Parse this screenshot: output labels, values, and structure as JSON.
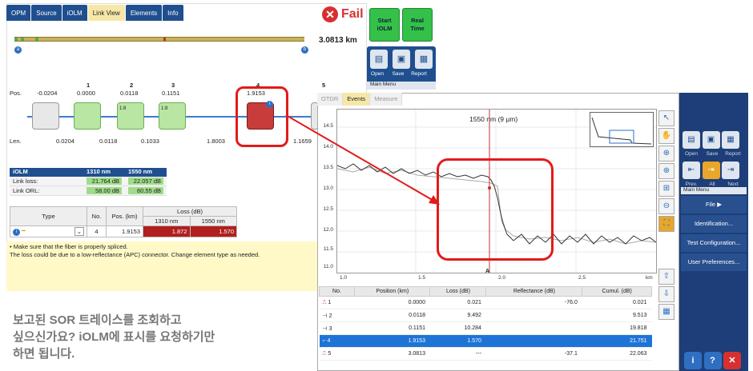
{
  "iolm": {
    "tabs": [
      "OPM",
      "Source",
      "iOLM",
      "Link View",
      "Elements",
      "Info"
    ],
    "active_tab": "Link View",
    "status": "Fail",
    "start_iolm_label": "Start\niOLM",
    "real_time_label": "Real\nTime",
    "toolbar": {
      "open": "Open",
      "save": "Save",
      "report": "Report"
    },
    "main_menu": "Main Menu",
    "total_distance": "3.0813 km",
    "pos_label": "Pos.",
    "len_label": "Len.",
    "positions": [
      "-0.0204",
      "0.0000",
      "0.0118",
      "0.1151",
      "1.9153"
    ],
    "indices": [
      "1",
      "2",
      "3",
      "4",
      "5"
    ],
    "lengths": [
      "0.0204",
      "0.0118",
      "0.1033",
      "1.8003",
      "1.1659"
    ],
    "splitter_label": "1:8",
    "results": {
      "header": [
        "iOLM",
        "1310 nm",
        "1550 nm"
      ],
      "rows": [
        {
          "label": "Link loss:",
          "v1310": "21.764 dB",
          "v1550": "22.057 dB"
        },
        {
          "label": "Link ORL:",
          "v1310": "58.00 dB",
          "v1550": "60.55 dB"
        }
      ]
    },
    "event_table": {
      "headers": [
        "Type",
        "No.",
        "Pos. (km)",
        "Loss (dB)"
      ],
      "subheaders": [
        "1310 nm",
        "1550 nm"
      ],
      "row": {
        "no": "4",
        "pos": "1.9153",
        "loss1310": "1.872",
        "loss1550": "1.570"
      }
    },
    "note_lines": [
      "• Make sure that the fiber is properly spliced.",
      "The loss could be due to a low-reflectance (APC) connector. Change element type as needed."
    ]
  },
  "caption": [
    "보고된 SOR 트레이스를 조회하고",
    "싶으신가요? iOLM에 표시를 요청하기만",
    "하면 됩니다."
  ],
  "otdr": {
    "tabs": [
      "OTDR",
      "Events",
      "Measure"
    ],
    "active_tab": "Events",
    "wavelength_label": "1550 nm (9 µm)",
    "marker_label": "A",
    "y_ticks": [
      "14.5",
      "14.0",
      "13.5",
      "13.0",
      "12.5",
      "12.0",
      "11.5",
      "11.0"
    ],
    "x_ticks": [
      "1.0",
      "1.5",
      "2.0",
      "2.5",
      "km"
    ],
    "table_headers": [
      "No.",
      "Position (km)",
      "Loss (dB)",
      "Reflectance (dB)",
      "Cumul. (dB)"
    ],
    "rows": [
      {
        "no": "1",
        "pos": "0.0000",
        "loss": "0.021",
        "refl": "-76.0",
        "cumul": "0.021"
      },
      {
        "no": "2",
        "pos": "0.0118",
        "loss": "9.492",
        "refl": "",
        "cumul": "9.513"
      },
      {
        "no": "3",
        "pos": "0.1151",
        "loss": "10.284",
        "refl": "",
        "cumul": "19.818"
      },
      {
        "no": "4",
        "pos": "1.9153",
        "loss": "1.570",
        "refl": "",
        "cumul": "21.751"
      },
      {
        "no": "5",
        "pos": "3.0813",
        "loss": "---",
        "refl": "-37.1",
        "cumul": "22.063"
      }
    ],
    "selected_row": 3
  },
  "right_panel": {
    "toolbar": {
      "open": "Open",
      "save": "Save",
      "report": "Report"
    },
    "nav": {
      "prev": "Prev.",
      "all": "All",
      "next": "Next"
    },
    "main_menu": "Main Menu",
    "menu_items": [
      "File",
      "Identification...",
      "Test Configuration...",
      "User Preferences..."
    ]
  },
  "colors": {
    "accent_blue": "#1f4f8f",
    "fail_red": "#d73030",
    "highlight_red": "#e21b1b",
    "pass_green": "#34c049"
  }
}
